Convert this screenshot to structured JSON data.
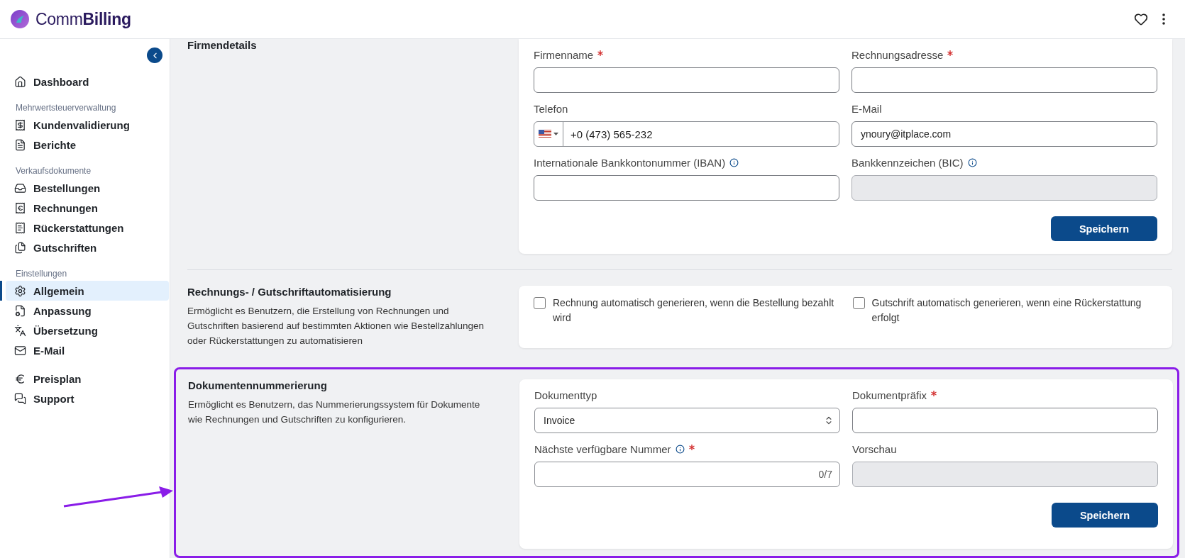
{
  "brand": {
    "light": "Comm",
    "bold": "Billing"
  },
  "sidebar": {
    "groups": [
      {
        "items": [
          {
            "label": "Dashboard",
            "selected": false
          }
        ]
      },
      {
        "heading": "Mehrwertsteuerverwaltung",
        "items": [
          {
            "label": "Kundenvalidierung",
            "selected": false
          },
          {
            "label": "Berichte",
            "selected": false
          }
        ]
      },
      {
        "heading": "Verkaufsdokumente",
        "items": [
          {
            "label": "Bestellungen",
            "selected": false
          },
          {
            "label": "Rechnungen",
            "selected": false
          },
          {
            "label": "Rückerstattungen",
            "selected": false
          },
          {
            "label": "Gutschriften",
            "selected": false
          }
        ]
      },
      {
        "heading": "Einstellungen",
        "items": [
          {
            "label": "Allgemein",
            "selected": true
          },
          {
            "label": "Anpassung",
            "selected": false
          },
          {
            "label": "Übersetzung",
            "selected": false
          },
          {
            "label": "E-Mail",
            "selected": false
          }
        ]
      },
      {
        "items": [
          {
            "label": "Preisplan",
            "selected": false
          },
          {
            "label": "Support",
            "selected": false
          }
        ]
      }
    ]
  },
  "sections": [
    {
      "kind": "form",
      "title": "Firmendetails",
      "highlighted": false,
      "fields": [
        {
          "kind": "text",
          "label": "Firmenname",
          "required": true,
          "info": false,
          "disabled": false
        },
        {
          "kind": "text",
          "label": "Rechnungsadresse",
          "required": true,
          "info": false,
          "disabled": false
        },
        {
          "kind": "phone",
          "label": "Telefon",
          "required": false,
          "info": false,
          "disabled": false,
          "value": "+0 (473) 565-232"
        },
        {
          "kind": "text",
          "label": "E-Mail",
          "required": false,
          "info": false,
          "disabled": false,
          "value": "ynoury@itplace.com"
        },
        {
          "kind": "text",
          "label": "Internationale Bankkontonummer (IBAN)",
          "required": false,
          "info": true,
          "disabled": false
        },
        {
          "kind": "text",
          "label": "Bankkennzeichen (BIC)",
          "required": false,
          "info": true,
          "disabled": true
        }
      ],
      "button": "Speichern"
    },
    {
      "kind": "checkboxes",
      "title": "Rechnungs- / Gutschriftautomatisierung",
      "highlighted": false,
      "description": "Ermöglicht es Benutzern, die Erstellung von Rechnungen und Gutschriften basierend auf bestimmten Aktionen wie Bestellzahlungen oder Rückerstattungen zu automatisieren",
      "options": [
        {
          "label": "Rechnung automatisch generieren, wenn die Bestellung bezahlt wird",
          "checked": false
        },
        {
          "label": "Gutschrift automatisch generieren, wenn eine Rückerstattung erfolgt",
          "checked": false
        }
      ]
    },
    {
      "kind": "form",
      "title": "Dokumentennummerierung",
      "highlighted": true,
      "description": "Ermöglicht es Benutzern, das Nummerierungssystem für Dokumente wie Rechnungen und Gutschriften zu konfigurieren.",
      "fields": [
        {
          "kind": "select",
          "label": "Dokumenttyp",
          "required": false,
          "info": false,
          "disabled": false,
          "value": "Invoice"
        },
        {
          "kind": "text",
          "label": "Dokumentpräfix",
          "required": true,
          "info": false,
          "disabled": false
        },
        {
          "kind": "counter",
          "label": "Nächste verfügbare Nummer",
          "required": true,
          "info": true,
          "disabled": false,
          "counter": "0/7"
        },
        {
          "kind": "text",
          "label": "Vorschau",
          "required": false,
          "info": false,
          "disabled": true
        }
      ],
      "button": "Speichern"
    }
  ]
}
